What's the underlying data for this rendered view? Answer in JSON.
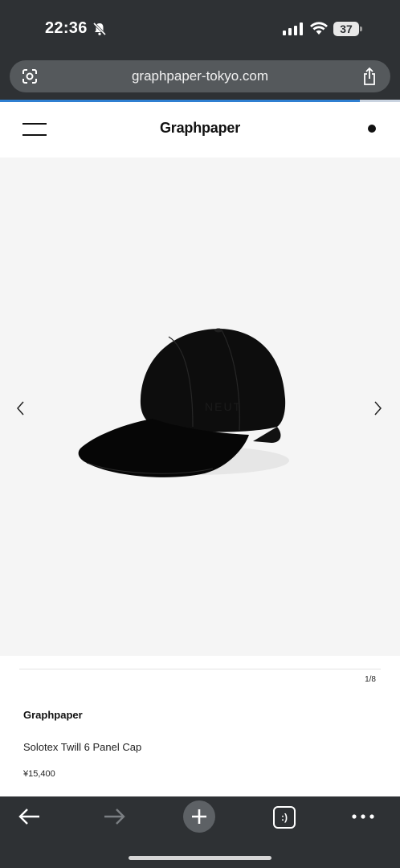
{
  "status_bar": {
    "time": "22:36",
    "battery": "37",
    "icons": [
      "bell-slash-icon",
      "signal-icon",
      "wifi-icon",
      "battery-icon"
    ]
  },
  "browser": {
    "url": "graphpaper-tokyo.com",
    "load_progress": 0.9,
    "accent_color": "#2f7fd1",
    "chrome_color": "#2e3134",
    "tabs_label": ":)"
  },
  "site": {
    "brand": "Graphpaper",
    "menu_icon": "hamburger-menu-icon",
    "cart_icon": "cart-dot-icon"
  },
  "gallery": {
    "counter": "1/8",
    "image": "black-cap-photo",
    "background": "#f5f5f5"
  },
  "product": {
    "brand": "Graphpaper",
    "name": "Solotex Twill 6 Panel Cap",
    "price": "¥15,400"
  }
}
